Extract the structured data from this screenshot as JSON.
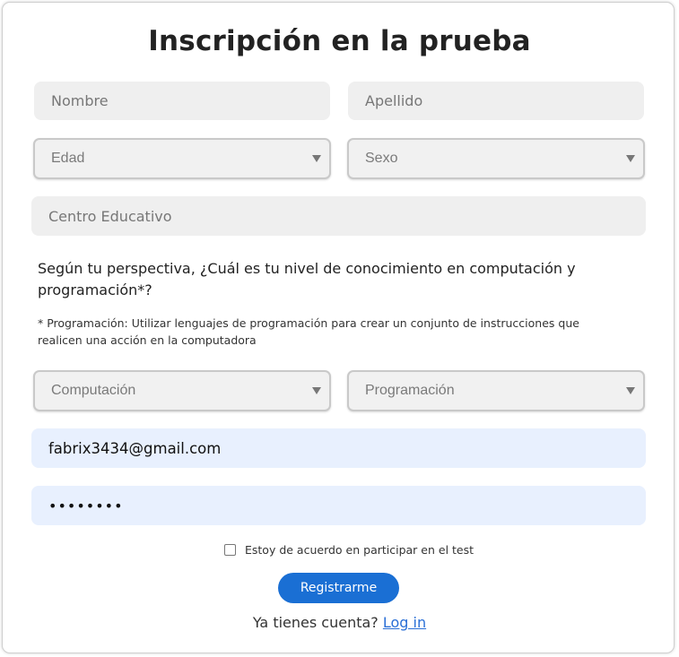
{
  "form": {
    "title": "Inscripción en la prueba",
    "nombre_placeholder": "Nombre",
    "apellido_placeholder": "Apellido",
    "edad_selected": "Edad",
    "sexo_selected": "Sexo",
    "centro_placeholder": "Centro Educativo",
    "question": "Según tu perspectiva, ¿Cuál es tu nivel de conocimiento en computación y programación*?",
    "note": "* Programación: Utilizar lenguajes de programación para crear un conjunto de instrucciones que realicen una acción en la computadora",
    "computacion_selected": "Computación",
    "programacion_selected": "Programación",
    "email_value": "fabrix3434@gmail.com",
    "password_value": "••••••••",
    "checkbox_label": "Estoy de acuerdo en participar en el test",
    "submit_label": "Registrarme",
    "login_prompt": "Ya tienes cuenta?",
    "login_link": "Log in"
  },
  "colors": {
    "accent": "#1a6fd4",
    "autofill_bg": "#e8f0fe",
    "input_bg": "#efefef"
  }
}
